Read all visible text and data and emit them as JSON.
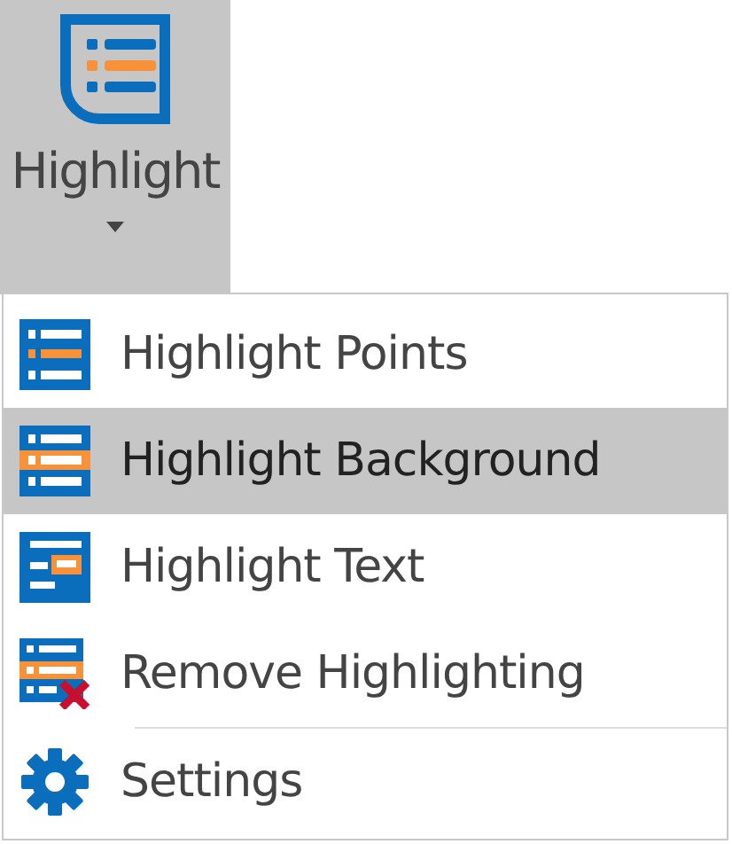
{
  "ribbon_button": {
    "label": "Highlight",
    "expanded": true
  },
  "menu": {
    "items": [
      {
        "kind": "points",
        "label": "Highlight Points",
        "selected": false
      },
      {
        "kind": "background",
        "label": "Highlight Background",
        "selected": true
      },
      {
        "kind": "text",
        "label": "Highlight Text",
        "selected": false
      },
      {
        "kind": "remove",
        "label": "Remove Highlighting",
        "selected": false
      },
      {
        "kind": "settings",
        "label": "Settings",
        "selected": false
      }
    ]
  }
}
